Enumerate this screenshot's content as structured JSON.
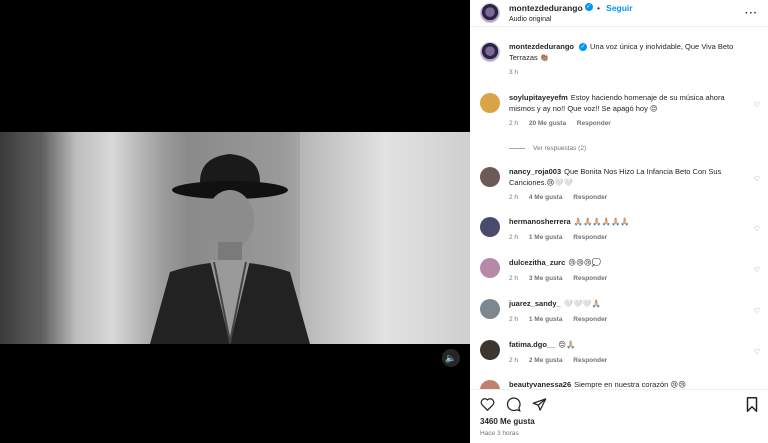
{
  "header": {
    "username": "montezdedurango",
    "follow_label": "Seguir",
    "subtitle": "Audio original",
    "more_icon": "more-horizontal-icon"
  },
  "caption": {
    "username": "montezdedurango",
    "text": "Una voz única y inolvidable, Que Viva Beto Terrazas 👏🏽",
    "time": "3 h"
  },
  "comments": [
    {
      "username": "soylupitayeyefm",
      "text": "Estoy haciendo homenaje de su música ahora mismos y ay no!! Que voz!! Se apagó hoy 😔",
      "time": "2 h",
      "likes": "20 Me gusta",
      "reply": "Responder",
      "avatar_color": "#d9a347"
    },
    {
      "username": "nancy_roja003",
      "text": "Que Bonita Nos Hizo La Infancia Beto Con Sus Canciones.😢🤍🤍",
      "time": "2 h",
      "likes": "4 Me gusta",
      "reply": "Responder",
      "avatar_color": "#6b5a55"
    },
    {
      "username": "hermanosherrera",
      "text": "🙏🏼🙏🏼🙏🏼🙏🏼🙏🏼🙏🏼",
      "time": "2 h",
      "likes": "1 Me gusta",
      "reply": "Responder",
      "avatar_color": "#4a4a6a"
    },
    {
      "username": "dulcezitha_zurc",
      "text": "😢😢😢💭",
      "time": "2 h",
      "likes": "3 Me gusta",
      "reply": "Responder",
      "avatar_color": "#b58aa8"
    },
    {
      "username": "juarez_sandy_",
      "text": "🤍🤍🤍🙏🏼",
      "time": "2 h",
      "likes": "1 Me gusta",
      "reply": "Responder",
      "avatar_color": "#7c8790"
    },
    {
      "username": "fatima.dgo__",
      "text": "😔🙏🏼",
      "time": "2 h",
      "likes": "2 Me gusta",
      "reply": "Responder",
      "avatar_color": "#3d3530"
    },
    {
      "username": "beautyvanessa26",
      "text": "Siempre en nuestra corazón 😢😢",
      "time": "",
      "likes": "",
      "reply": "",
      "avatar_color": "#c08070"
    }
  ],
  "view_replies": "Ver respuestas (2)",
  "footer": {
    "likes": "3460 Me gusta",
    "time_ago": "Hace 3 horas"
  },
  "colors": {
    "accent": "#0095f6",
    "muted": "#737373",
    "text": "#262626"
  }
}
